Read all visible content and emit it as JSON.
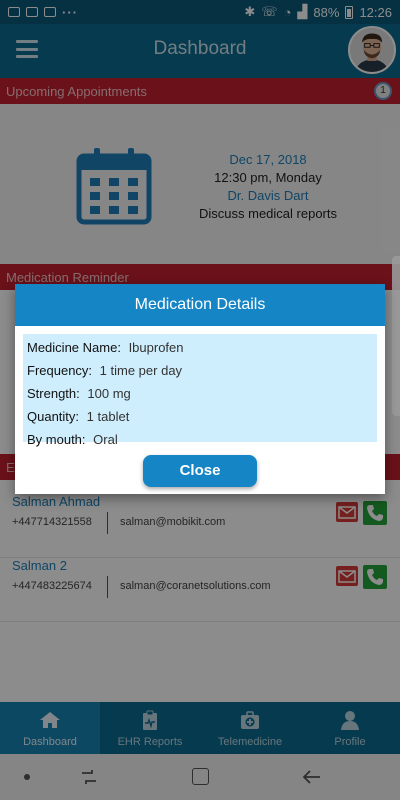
{
  "status_bar": {
    "battery": "88%",
    "time": "12:26"
  },
  "header": {
    "title": "Dashboard"
  },
  "appointments": {
    "section_title": "Upcoming Appointments",
    "count": "1",
    "date": "Dec 17, 2018",
    "time": "12:30 pm, Monday",
    "doctor": "Dr. Davis Dart",
    "purpose": "Discuss medical reports"
  },
  "medication_reminder": {
    "section_title": "Medication Reminder"
  },
  "emergency": {
    "section_title_visible": "E"
  },
  "contacts": [
    {
      "name": "Salman Ahmad",
      "phone": "+447714321558",
      "email": "salman@mobikit.com"
    },
    {
      "name": "Salman 2",
      "phone": "+447483225674",
      "email": "salman@coranetsolutions.com"
    }
  ],
  "modal": {
    "title": "Medication Details",
    "rows": [
      {
        "label": "Medicine Name:",
        "value": "Ibuprofen"
      },
      {
        "label": "Frequency:",
        "value": "1 time per day"
      },
      {
        "label": "Strength:",
        "value": "100 mg"
      },
      {
        "label": "Quantity:",
        "value": "1 tablet"
      },
      {
        "label": "By mouth:",
        "value": "Oral"
      }
    ],
    "close_label": "Close"
  },
  "tabs": [
    {
      "label": "Dashboard",
      "icon": "home-icon",
      "active": true
    },
    {
      "label": "EHR Reports",
      "icon": "clipboard-icon",
      "active": false
    },
    {
      "label": "Telemedicine",
      "icon": "medical-kit-icon",
      "active": false
    },
    {
      "label": "Profile",
      "icon": "person-icon",
      "active": false
    }
  ],
  "colors": {
    "header": "#0a6a90",
    "section_red": "#c42030",
    "accent_blue": "#1585c6",
    "modal_body": "#cfeefd"
  }
}
